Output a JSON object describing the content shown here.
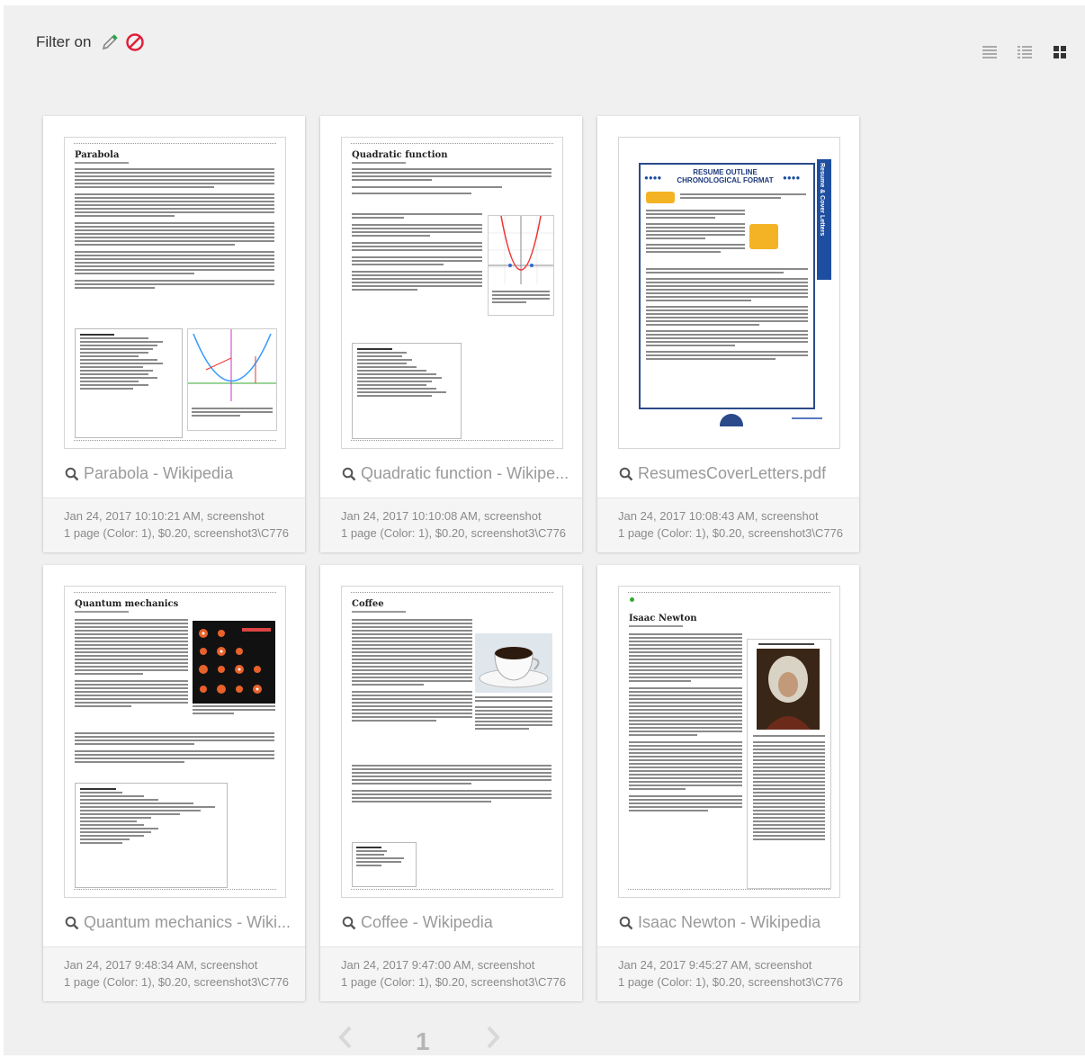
{
  "toolbar": {
    "filter_label": "Filter on",
    "view_modes": [
      "compact-list-view-icon",
      "detail-list-view-icon",
      "grid-view-icon"
    ]
  },
  "colors": {
    "accent_green": "#27a844",
    "clear_red": "#e11d3a",
    "muted_text": "#9a9a9a"
  },
  "cards": [
    {
      "title": "Parabola - Wikipedia",
      "meta1": "Jan 24, 2017 10:10:21 AM, screenshot",
      "meta2": "1 page (Color: 1), $0.20, screenshot3\\C776...",
      "doc_title": "Parabola"
    },
    {
      "title": "Quadratic function - Wikipe...",
      "meta1": "Jan 24, 2017 10:10:08 AM, screenshot",
      "meta2": "1 page (Color: 1), $0.20, screenshot3\\C776...",
      "doc_title": "Quadratic function"
    },
    {
      "title": "ResumesCoverLetters.pdf",
      "meta1": "Jan 24, 2017 10:08:43 AM, screenshot",
      "meta2": "1 page (Color: 1), $0.20, screenshot3\\C776...",
      "doc_title": "RESUME OUTLINE CHRONOLOGICAL FORMAT",
      "doc_side": "Resume & Cover Letters"
    },
    {
      "title": "Quantum mechanics - Wiki...",
      "meta1": "Jan 24, 2017 9:48:34 AM, screenshot",
      "meta2": "1 page (Color: 1), $0.20, screenshot3\\C776...",
      "doc_title": "Quantum mechanics"
    },
    {
      "title": "Coffee - Wikipedia",
      "meta1": "Jan 24, 2017 9:47:00 AM, screenshot",
      "meta2": "1 page (Color: 1), $0.20, screenshot3\\C776...",
      "doc_title": "Coffee"
    },
    {
      "title": "Isaac Newton - Wikipedia",
      "meta1": "Jan 24, 2017 9:45:27 AM, screenshot",
      "meta2": "1 page (Color: 1), $0.20, screenshot3\\C776...",
      "doc_title": "Isaac Newton"
    }
  ],
  "pagination": {
    "current_page": "1"
  }
}
